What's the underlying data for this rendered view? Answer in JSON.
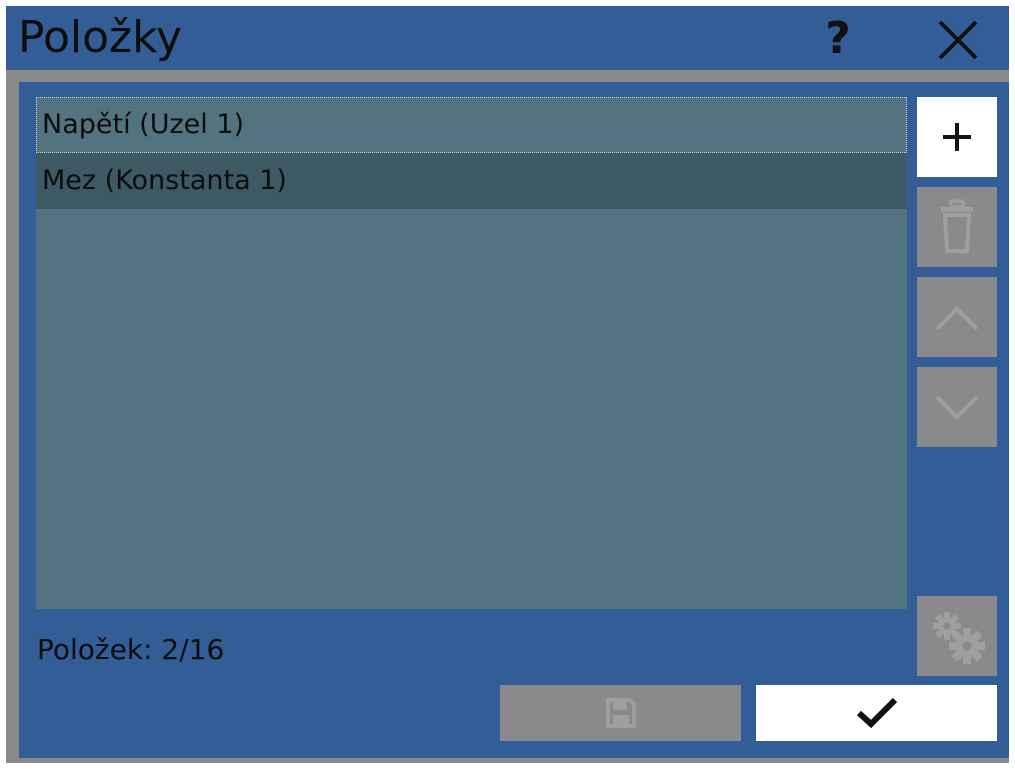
{
  "window": {
    "title": "Položky",
    "help_label": "?"
  },
  "list": {
    "items": [
      {
        "label": "Napětí (Uzel 1)"
      },
      {
        "label": "Mez (Konstanta 1)"
      }
    ]
  },
  "footer": {
    "count_label": "Položek: 2/16"
  },
  "icons": {
    "help": "question-mark-icon",
    "close": "close-icon",
    "add": "plus-icon",
    "delete": "trash-icon",
    "move_up": "chevron-up-icon",
    "move_down": "chevron-down-icon",
    "settings": "gears-icon",
    "save": "floppy-disk-icon",
    "confirm": "checkmark-icon"
  },
  "colors": {
    "frame": "#8a898c",
    "panel": "#335d97",
    "list_bg": "#52737f",
    "list_selected": "#3d5a64",
    "button_active": "#ffffff",
    "button_disabled": "#8a898c",
    "disabled_icon": "#9f9ea1"
  }
}
